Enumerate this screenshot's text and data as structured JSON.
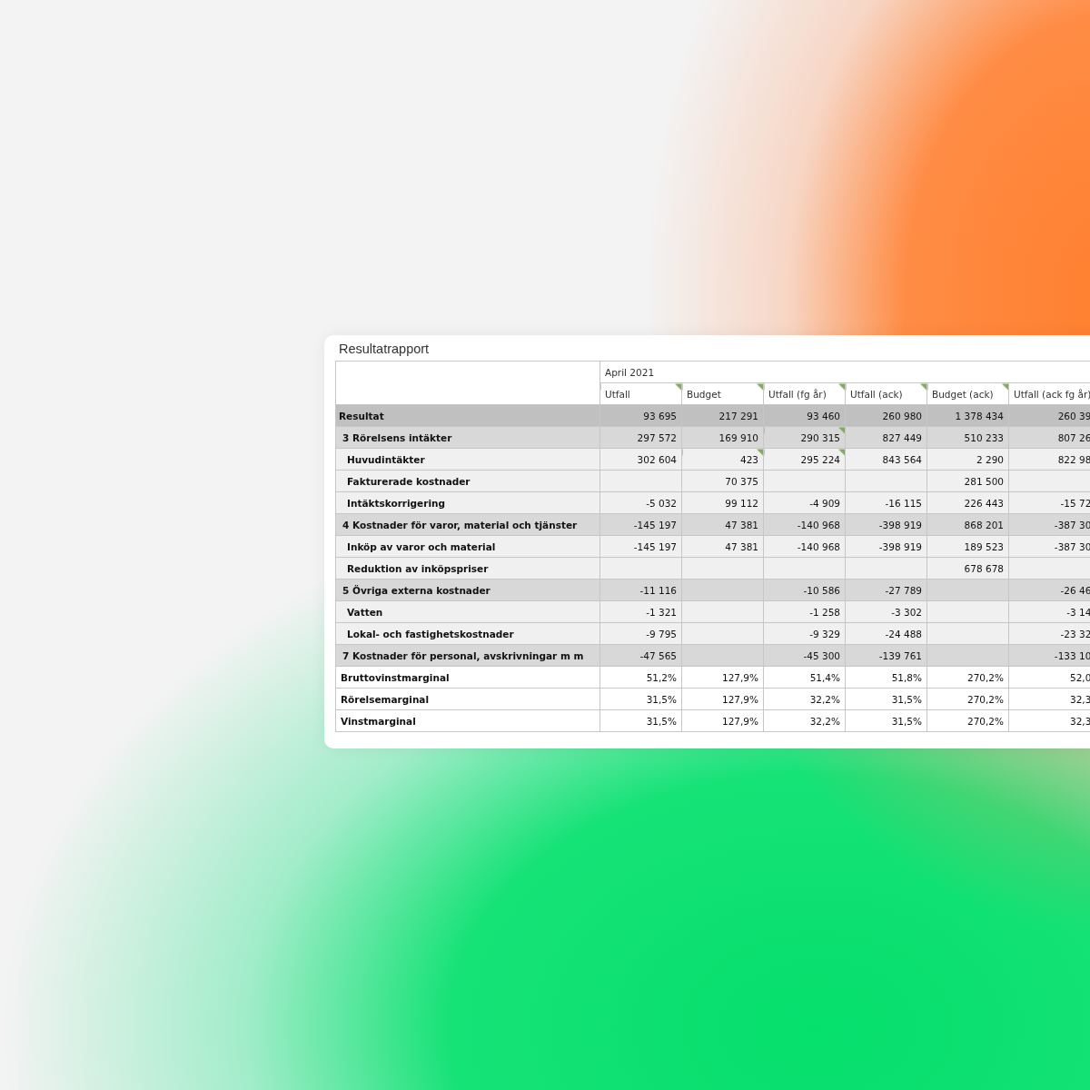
{
  "card": {
    "title": "Resultatrapport"
  },
  "table": {
    "period": "April 2021",
    "columns": [
      {
        "label": "Utfall",
        "note": true
      },
      {
        "label": "Budget",
        "note": true
      },
      {
        "label": "Utfall (fg år)",
        "note": true
      },
      {
        "label": "Utfall (ack)",
        "note": true
      },
      {
        "label": "Budget (ack)",
        "note": true
      },
      {
        "label": "Utfall (ack fg år)",
        "note": false
      }
    ],
    "rows": [
      {
        "kind": "total",
        "label": "Resultat",
        "cells": [
          "93 695",
          "217 291",
          "93 460",
          "260 980",
          "1 378 434",
          "260 39"
        ],
        "notes": [
          false,
          false,
          false,
          false,
          false,
          false
        ]
      },
      {
        "kind": "group",
        "label": "3 Rörelsens intäkter",
        "cells": [
          "297 572",
          "169 910",
          "290 315",
          "827 449",
          "510 233",
          "807 26"
        ],
        "notes": [
          false,
          false,
          true,
          false,
          false,
          false
        ]
      },
      {
        "kind": "item",
        "label": "Huvudintäkter",
        "cells": [
          "302 604",
          "423",
          "295 224",
          "843 564",
          "2 290",
          "822 98"
        ],
        "notes": [
          false,
          true,
          true,
          false,
          false,
          false
        ]
      },
      {
        "kind": "item",
        "label": "Fakturerade kostnader",
        "cells": [
          null,
          "70 375",
          null,
          null,
          "281 500",
          null
        ],
        "notes": [
          false,
          false,
          false,
          false,
          false,
          false
        ]
      },
      {
        "kind": "item",
        "label": "Intäktskorrigering",
        "cells": [
          "-5 032",
          "99 112",
          "-4 909",
          "-16 115",
          "226 443",
          "-15 72"
        ],
        "notes": [
          false,
          false,
          false,
          false,
          false,
          false
        ]
      },
      {
        "kind": "group",
        "label": "4 Kostnader för varor, material och tjänster",
        "cells": [
          "-145 197",
          "47 381",
          "-140 968",
          "-398 919",
          "868 201",
          "-387 30"
        ],
        "notes": [
          false,
          false,
          false,
          false,
          false,
          false
        ]
      },
      {
        "kind": "item",
        "label": "Inköp av varor och material",
        "cells": [
          "-145 197",
          "47 381",
          "-140 968",
          "-398 919",
          "189 523",
          "-387 30"
        ],
        "notes": [
          false,
          false,
          false,
          false,
          false,
          false
        ]
      },
      {
        "kind": "item",
        "label": "Reduktion av inköpspriser",
        "cells": [
          null,
          null,
          null,
          null,
          "678 678",
          null
        ],
        "notes": [
          false,
          false,
          false,
          false,
          false,
          false
        ]
      },
      {
        "kind": "group",
        "label": "5 Övriga externa kostnader",
        "cells": [
          "-11 116",
          null,
          "-10 586",
          "-27 789",
          null,
          "-26 46"
        ],
        "notes": [
          false,
          false,
          false,
          false,
          false,
          false
        ]
      },
      {
        "kind": "item",
        "label": "Vatten",
        "cells": [
          "-1 321",
          null,
          "-1 258",
          "-3 302",
          null,
          "-3 14"
        ],
        "notes": [
          false,
          false,
          false,
          false,
          false,
          false
        ]
      },
      {
        "kind": "item",
        "label": "Lokal- och fastighetskostnader",
        "cells": [
          "-9 795",
          null,
          "-9 329",
          "-24 488",
          null,
          "-23 32"
        ],
        "notes": [
          false,
          false,
          false,
          false,
          false,
          false
        ]
      },
      {
        "kind": "group",
        "label": "7 Kostnader för personal, avskrivningar m m",
        "cells": [
          "-47 565",
          null,
          "-45 300",
          "-139 761",
          null,
          "-133 10"
        ],
        "notes": [
          false,
          false,
          false,
          false,
          false,
          false
        ]
      },
      {
        "kind": "ratio",
        "label": "Bruttovinstmarginal",
        "cells": [
          "51,2%",
          "127,9%",
          "51,4%",
          "51,8%",
          "270,2%",
          "52,0"
        ],
        "notes": [
          false,
          false,
          false,
          false,
          false,
          false
        ]
      },
      {
        "kind": "ratio",
        "label": "Rörelsemarginal",
        "cells": [
          "31,5%",
          "127,9%",
          "32,2%",
          "31,5%",
          "270,2%",
          "32,3"
        ],
        "notes": [
          false,
          false,
          false,
          false,
          false,
          false
        ]
      },
      {
        "kind": "ratio",
        "label": "Vinstmarginal",
        "cells": [
          "31,5%",
          "127,9%",
          "32,2%",
          "31,5%",
          "270,2%",
          "32,3"
        ],
        "notes": [
          false,
          false,
          false,
          false,
          false,
          false
        ]
      }
    ]
  }
}
